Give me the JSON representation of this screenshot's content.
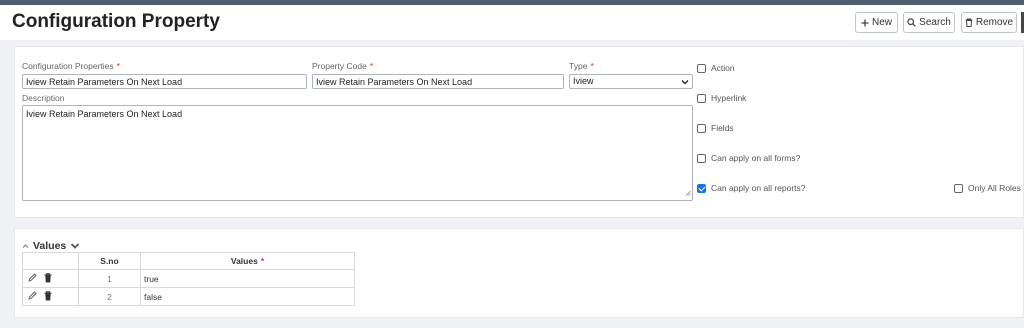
{
  "page": {
    "title": "Configuration Property"
  },
  "toolbar": {
    "new_label": "New",
    "search_label": "Search",
    "remove_label": "Remove"
  },
  "form": {
    "config_properties": {
      "label": "Configuration Properties",
      "value": "Iview Retain Parameters On Next Load"
    },
    "property_code": {
      "label": "Property Code",
      "value": "Iview Retain Parameters On Next Load"
    },
    "type": {
      "label": "Type",
      "value": "Iview"
    },
    "description": {
      "label": "Description",
      "value": "Iview Retain Parameters On Next Load"
    },
    "required_marker": "*"
  },
  "checkboxes": {
    "action": {
      "label": "Action",
      "checked": false
    },
    "hyperlink": {
      "label": "Hyperlink",
      "checked": false
    },
    "fields": {
      "label": "Fields",
      "checked": false
    },
    "all_forms": {
      "label": "Can apply on all forms?",
      "checked": false
    },
    "all_reports": {
      "label": "Can apply on all reports?",
      "checked": true
    },
    "only_all_roles": {
      "label": "Only All Roles",
      "checked": false
    }
  },
  "values_section": {
    "title": "Values",
    "columns": {
      "sno": "S.no",
      "values": "Values"
    },
    "rows": [
      {
        "sno": "1",
        "value": "true"
      },
      {
        "sno": "2",
        "value": "false"
      }
    ]
  },
  "colors": {
    "accent": "#1a73e8",
    "required": "#dd3333",
    "topbar": "#4d5e70"
  }
}
